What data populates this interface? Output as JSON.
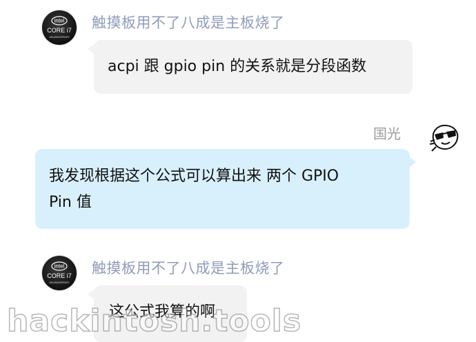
{
  "messages": [
    {
      "sender": "触摸板用不了八成是主板烧了",
      "text": "acpi 跟 gpio pin 的关系就是分段函数",
      "avatar": "intel-core-i7-icon"
    },
    {
      "sender": "国光",
      "line1": "我发现根据这个公式可以算出来 两个 GPIO",
      "line2": "Pin 值",
      "avatar": "sunglasses-face-icon"
    },
    {
      "sender": "触摸板用不了八成是主板烧了",
      "text": "这公式我算的啊",
      "avatar": "intel-core-i7-icon"
    }
  ],
  "avatar_badge": {
    "brand": "intel",
    "product": "CORE i7",
    "tagline": "40th ANNIVERSARY"
  },
  "watermark": "hackintosh.tools",
  "colors": {
    "incoming_bubble": "#f2f2f2",
    "outgoing_bubble": "#d8f0fb",
    "sender_name": "#8f9bb8"
  }
}
